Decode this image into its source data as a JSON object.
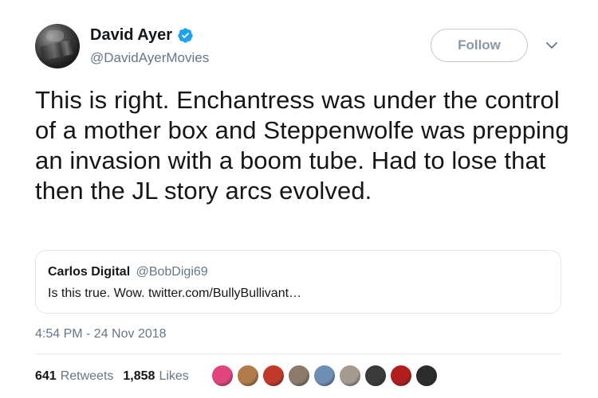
{
  "author": {
    "display_name": "David Ayer",
    "handle": "@DavidAyerMovies",
    "verified": true
  },
  "follow_label": "Follow",
  "tweet": {
    "text": "This is right. Enchantress was under the control of a mother box and Steppenwolfe was prepping an invasion with a boom tube. Had to lose that then the JL story arcs evolved.",
    "timestamp": "4:54 PM - 24 Nov 2018"
  },
  "quoted_tweet": {
    "display_name": "Carlos Digital",
    "handle": "@BobDigi69",
    "text": "Is this true. Wow. twitter.com/BullyBullivant…"
  },
  "stats": {
    "retweets_count": "641",
    "retweets_label": "Retweets",
    "likes_count": "1,858",
    "likes_label": "Likes"
  },
  "liker_avatar_colors": [
    "#e0457b",
    "#b07a4a",
    "#c0392b",
    "#8c7a6b",
    "#6e8fb3",
    "#a49a90",
    "#3a3a3a",
    "#b01e1e",
    "#2b2b2b"
  ],
  "colors": {
    "verified_blue": "#1da1f2",
    "secondary_text": "#657786"
  }
}
